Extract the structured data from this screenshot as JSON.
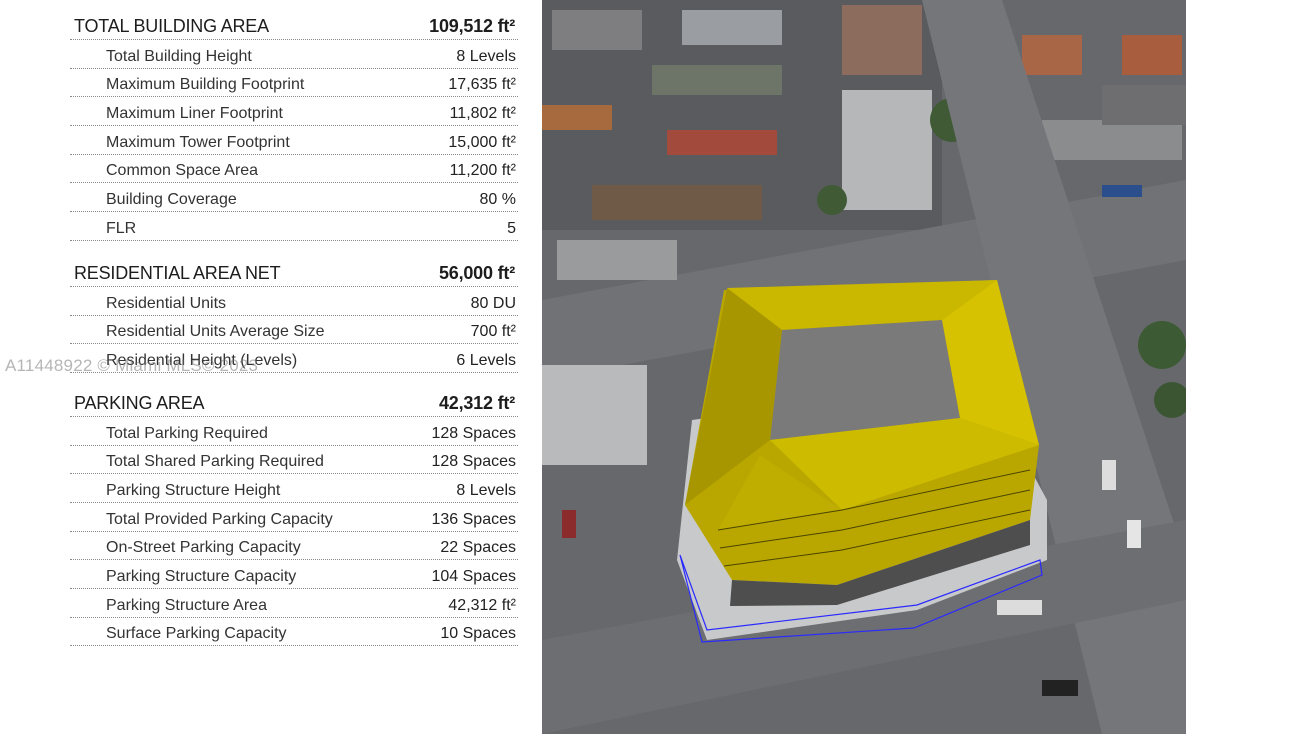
{
  "sections": [
    {
      "title": "TOTAL BUILDING AREA",
      "value": "109,512 ft²",
      "rows": [
        {
          "label": "Total Building Height",
          "value": "8 Levels"
        },
        {
          "label": "Maximum Building Footprint",
          "value": "17,635 ft²"
        },
        {
          "label": "Maximum Liner Footprint",
          "value": "11,802 ft²"
        },
        {
          "label": "Maximum Tower Footprint",
          "value": "15,000 ft²"
        },
        {
          "label": "Common Space Area",
          "value": "11,200 ft²"
        },
        {
          "label": "Building Coverage",
          "value": "80 %"
        },
        {
          "label": "FLR",
          "value": "5"
        }
      ]
    },
    {
      "title": "RESIDENTIAL AREA NET",
      "value": "56,000 ft²",
      "rows": [
        {
          "label": "Residential Units",
          "value": "80 DU"
        },
        {
          "label": "Residential Units Average Size",
          "value": "700 ft²"
        },
        {
          "label": "Residential Height (Levels)",
          "value": "6 Levels"
        }
      ]
    },
    {
      "title": "PARKING AREA",
      "value": "42,312 ft²",
      "rows": [
        {
          "label": "Total Parking Required",
          "value": "128 Spaces"
        },
        {
          "label": "Total Shared Parking Required",
          "value": "128 Spaces"
        },
        {
          "label": "Parking Structure Height",
          "value": "8 Levels"
        },
        {
          "label": "Total Provided Parking Capacity",
          "value": "136 Spaces"
        },
        {
          "label": "On-Street Parking Capacity",
          "value": "22 Spaces"
        },
        {
          "label": "Parking Structure Capacity",
          "value": "104 Spaces"
        },
        {
          "label": "Parking Structure Area",
          "value": "42,312 ft²"
        },
        {
          "label": "Surface Parking Capacity",
          "value": "10 Spaces"
        }
      ]
    }
  ],
  "watermark": "A11448922 © Miami MLS© 2023",
  "colors": {
    "building_facade": "#c9b400",
    "building_roof": "#7a7a7a",
    "road": "#6e7074",
    "sidewalk": "#b9bbbd"
  }
}
